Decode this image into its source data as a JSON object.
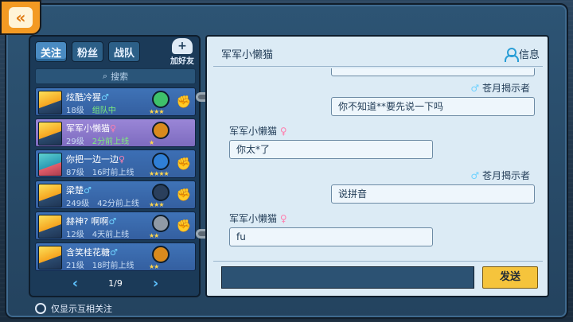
{
  "nav": {
    "back_glyph": "«"
  },
  "tabs": [
    {
      "label": "关注",
      "active": true
    },
    {
      "label": "粉丝",
      "active": false
    },
    {
      "label": "战队",
      "active": false
    }
  ],
  "add_friend_label": "加好友",
  "search_placeholder": "搜索",
  "friends": [
    {
      "name": "炫酷冷猩",
      "gender": "♂",
      "level": "18级",
      "status": "组队中",
      "badge_color": "#3ec16a",
      "stars": "★★★",
      "selected": false
    },
    {
      "name": "军军小懒猫",
      "gender": "♀",
      "level": "29级",
      "status": "2分前上线",
      "badge_color": "#d98a1d",
      "stars": "★",
      "selected": true
    },
    {
      "name": "你把一边一边",
      "gender": "♀",
      "level": "87级",
      "status": "16时前上线",
      "badge_color": "#2f7fd6",
      "stars": "★★★★",
      "selected": false
    },
    {
      "name": "梁楚",
      "gender": "♂",
      "level": "249级",
      "status": "42分前上线",
      "badge_color": "#2a3f5c",
      "stars": "★★★",
      "selected": false
    },
    {
      "name": "赫神? 啊啊",
      "gender": "♂",
      "level": "12级",
      "status": "4天前上线",
      "badge_color": "#8f9aa6",
      "stars": "★★",
      "selected": false
    },
    {
      "name": "含笑桂花糖",
      "gender": "♂",
      "level": "21级",
      "status": "18时前上线",
      "badge_color": "#d98a1d",
      "stars": "★★",
      "selected": false
    }
  ],
  "pager": {
    "prev": "‹",
    "page": "1/9",
    "next": "›"
  },
  "mutual_only_label": "仅显示互相关注",
  "chat": {
    "title": "军军小懒猫",
    "info_label": "信息",
    "messages": [
      {
        "side": "right",
        "sender": "苍月揭示者",
        "gender": "♂",
        "text": "你不知道**要先说一下吗"
      },
      {
        "side": "left",
        "sender": "军军小懒猫",
        "gender": "♀",
        "text": "你太*了"
      },
      {
        "side": "right",
        "sender": "苍月揭示者",
        "gender": "♂",
        "text": "说拼音"
      },
      {
        "side": "left",
        "sender": "军军小懒猫",
        "gender": "♀",
        "text": "fu"
      }
    ],
    "send_label": "发送"
  }
}
